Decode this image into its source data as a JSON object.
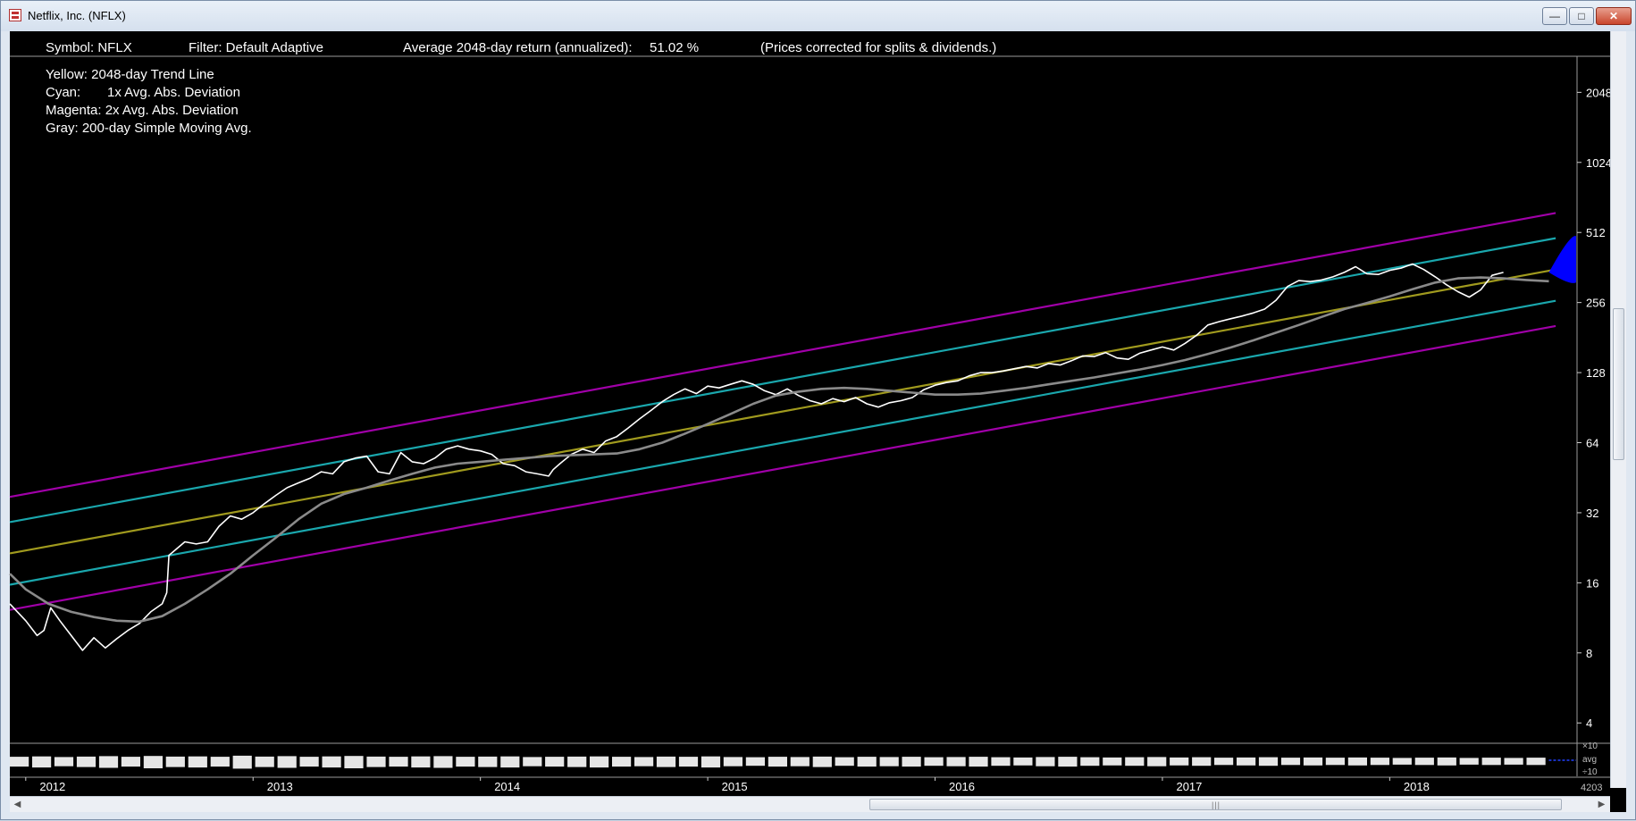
{
  "window": {
    "title": "Netflix, Inc. (NFLX)"
  },
  "header": {
    "symbol": "Symbol: NFLX",
    "filter": "Filter: Default Adaptive",
    "avg_return": "Average 2048-day return (annualized):",
    "avg_return_value": "51.02 %",
    "note": "(Prices corrected for splits & dividends.)"
  },
  "legend": {
    "lines": [
      "Yellow: 2048-day Trend Line",
      "Cyan:",
      "1x Avg. Abs. Deviation",
      "Magenta: 2x Avg. Abs. Deviation",
      "Gray: 200-day Simple Moving Avg."
    ]
  },
  "chart_data": {
    "type": "line",
    "y_scale": "log2",
    "ylim": [
      3.3,
      2900
    ],
    "xlim": [
      2011.93,
      2018.82
    ],
    "y_ticks": [
      2048,
      1024,
      512,
      256,
      128,
      64,
      32,
      16,
      8,
      4
    ],
    "x_tick_labels": [
      {
        "label": "2012",
        "x": 2012.0
      },
      {
        "label": "2013",
        "x": 2013.0
      },
      {
        "label": "2014",
        "x": 2014.0
      },
      {
        "label": "2015",
        "x": 2015.0
      },
      {
        "label": "2016",
        "x": 2016.0
      },
      {
        "label": "2017",
        "x": 2017.0
      },
      {
        "label": "2018",
        "x": 2018.0
      }
    ],
    "trend": {
      "start": [
        2011.93,
        21.4
      ],
      "end": [
        2018.73,
        355
      ]
    },
    "deviation_bands": [
      {
        "band": "1x",
        "factor": 1.363,
        "color": "#1aa7ad"
      },
      {
        "band": "2x",
        "factor": 1.749,
        "color": "#a000a8"
      }
    ],
    "colors": {
      "price": "#ffffff",
      "trend": "#a09a1e",
      "sma": "#8a8a8a",
      "projection": "#0000ff",
      "volume": "#ffffff"
    },
    "price": {
      "x": [
        2011.93,
        2012.0,
        2012.05,
        2012.08,
        2012.11,
        2012.15,
        2012.2,
        2012.25,
        2012.3,
        2012.35,
        2012.4,
        2012.45,
        2012.5,
        2012.55,
        2012.6,
        2012.62,
        2012.63,
        2012.7,
        2012.75,
        2012.8,
        2012.85,
        2012.9,
        2012.95,
        2013.0,
        2013.05,
        2013.1,
        2013.15,
        2013.2,
        2013.25,
        2013.3,
        2013.35,
        2013.4,
        2013.45,
        2013.5,
        2013.55,
        2013.6,
        2013.65,
        2013.7,
        2013.75,
        2013.8,
        2013.85,
        2013.9,
        2013.95,
        2014.0,
        2014.05,
        2014.1,
        2014.15,
        2014.2,
        2014.25,
        2014.3,
        2014.32,
        2014.35,
        2014.4,
        2014.45,
        2014.5,
        2014.55,
        2014.6,
        2014.65,
        2014.7,
        2014.75,
        2014.8,
        2014.85,
        2014.9,
        2014.95,
        2015.0,
        2015.05,
        2015.1,
        2015.15,
        2015.2,
        2015.25,
        2015.3,
        2015.35,
        2015.4,
        2015.45,
        2015.5,
        2015.55,
        2015.6,
        2015.65,
        2015.7,
        2015.75,
        2015.8,
        2015.85,
        2015.9,
        2015.95,
        2016.0,
        2016.05,
        2016.1,
        2016.15,
        2016.2,
        2016.25,
        2016.3,
        2016.35,
        2016.4,
        2016.45,
        2016.5,
        2016.55,
        2016.6,
        2016.65,
        2016.7,
        2016.75,
        2016.8,
        2016.85,
        2016.9,
        2016.95,
        2017.0,
        2017.05,
        2017.1,
        2017.15,
        2017.2,
        2017.25,
        2017.3,
        2017.35,
        2017.4,
        2017.45,
        2017.5,
        2017.55,
        2017.6,
        2017.65,
        2017.7,
        2017.75,
        2017.8,
        2017.85,
        2017.9,
        2017.95,
        2018.0,
        2018.05,
        2018.1,
        2018.15,
        2018.2,
        2018.25,
        2018.3,
        2018.35,
        2018.4,
        2018.45,
        2018.5,
        2018.55,
        2018.6,
        2018.65,
        2018.7
      ],
      "y": [
        13,
        11,
        9.5,
        10,
        12.5,
        11,
        9.5,
        8.2,
        9.3,
        8.4,
        9.2,
        10,
        10.7,
        12,
        13,
        14.5,
        21,
        24,
        23.5,
        24,
        28,
        31,
        30,
        32,
        35,
        38,
        41,
        43,
        45,
        48,
        47,
        53,
        55,
        56,
        48,
        47,
        58,
        53,
        52,
        55,
        60,
        62,
        60,
        59,
        57,
        52,
        51,
        48,
        47,
        46,
        49,
        52,
        57,
        60,
        58,
        65,
        68,
        74,
        81,
        88,
        96,
        103,
        109,
        104,
        112,
        110,
        114,
        118,
        114,
        107,
        103,
        109,
        102,
        97,
        94,
        99,
        96,
        100,
        94,
        91,
        95,
        97,
        100,
        108,
        113,
        116,
        118,
        124,
        128,
        128,
        130,
        133,
        136,
        134,
        140,
        138,
        144,
        151,
        150,
        156,
        148,
        146,
        155,
        160,
        165,
        160,
        171,
        185,
        205,
        212,
        218,
        224,
        231,
        240,
        262,
        300,
        318,
        315,
        320,
        330,
        345,
        365,
        340,
        338,
        352,
        360,
        375,
        355,
        330,
        305,
        285,
        270,
        290,
        335,
        345
      ]
    },
    "sma": {
      "x": [
        2011.93,
        2012.0,
        2012.1,
        2012.2,
        2012.3,
        2012.4,
        2012.5,
        2012.6,
        2012.7,
        2012.8,
        2012.9,
        2013.0,
        2013.1,
        2013.2,
        2013.3,
        2013.4,
        2013.5,
        2013.6,
        2013.7,
        2013.8,
        2013.9,
        2014.0,
        2014.1,
        2014.2,
        2014.3,
        2014.4,
        2014.5,
        2014.6,
        2014.7,
        2014.8,
        2014.9,
        2015.0,
        2015.1,
        2015.2,
        2015.3,
        2015.4,
        2015.5,
        2015.6,
        2015.7,
        2015.8,
        2015.9,
        2016.0,
        2016.1,
        2016.2,
        2016.3,
        2016.4,
        2016.5,
        2016.6,
        2016.7,
        2016.8,
        2016.9,
        2017.0,
        2017.1,
        2017.2,
        2017.3,
        2017.4,
        2017.5,
        2017.6,
        2017.7,
        2017.8,
        2017.9,
        2018.0,
        2018.1,
        2018.2,
        2018.3,
        2018.4,
        2018.5,
        2018.6,
        2018.7
      ],
      "y": [
        17.5,
        15,
        13,
        12,
        11.4,
        11,
        10.9,
        11.5,
        13,
        15,
        17.5,
        21,
        25,
        30,
        35,
        38.5,
        41,
        44,
        47,
        50,
        52,
        53,
        54,
        55,
        56,
        56.5,
        57,
        57.5,
        60,
        64,
        70,
        77,
        85,
        94,
        102,
        106,
        109,
        110,
        109,
        107,
        105,
        103,
        103,
        104,
        107,
        110,
        114,
        118,
        122,
        127,
        132,
        138,
        145,
        154,
        164,
        176,
        190,
        205,
        222,
        240,
        255,
        272,
        292,
        312,
        325,
        328,
        325,
        320,
        316
      ]
    },
    "volume": [
      0.5,
      0.6,
      0.45,
      0.55,
      0.65,
      0.5,
      0.7,
      0.55,
      0.6,
      0.5,
      0.75,
      0.55,
      0.65,
      0.5,
      0.6,
      0.7,
      0.55,
      0.5,
      0.6,
      0.65,
      0.5,
      0.55,
      0.6,
      0.45,
      0.5,
      0.55,
      0.6,
      0.5,
      0.45,
      0.55,
      0.5,
      0.6,
      0.45,
      0.4,
      0.5,
      0.45,
      0.55,
      0.4,
      0.5,
      0.45,
      0.5,
      0.4,
      0.45,
      0.5,
      0.4,
      0.35,
      0.45,
      0.5,
      0.4,
      0.35,
      0.4,
      0.45,
      0.35,
      0.4,
      0.3,
      0.35,
      0.4,
      0.3,
      0.35,
      0.3,
      0.35,
      0.3,
      0.25,
      0.3,
      0.35,
      0.25,
      0.3,
      0.25,
      0.3
    ],
    "volume_axis_labels": [
      "×10",
      "avg",
      "÷10"
    ],
    "last_count": "4203"
  }
}
